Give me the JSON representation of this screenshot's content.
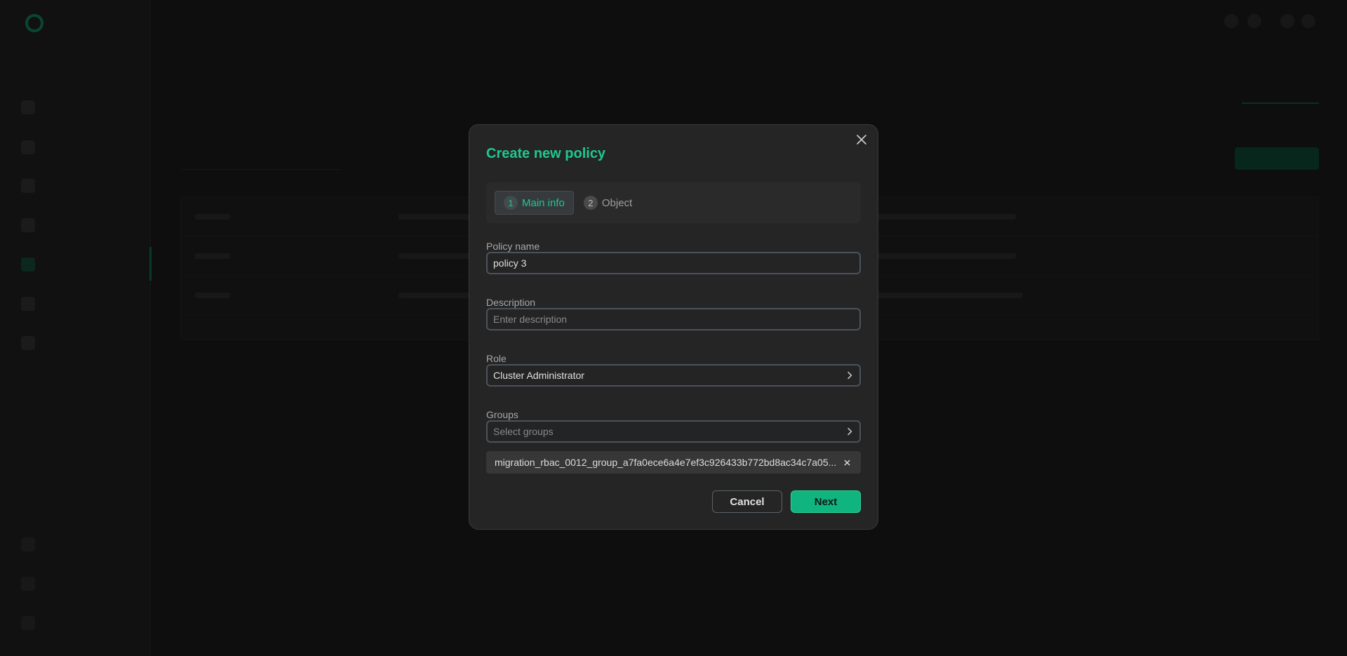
{
  "modal": {
    "title": "Create new policy",
    "steps": [
      {
        "number": "1",
        "label": "Main info",
        "active": true
      },
      {
        "number": "2",
        "label": "Object",
        "active": false
      }
    ],
    "fields": {
      "policy_name": {
        "label": "Policy name",
        "value": "policy 3"
      },
      "description": {
        "label": "Description",
        "placeholder": "Enter description"
      },
      "role": {
        "label": "Role",
        "value": "Cluster Administrator"
      },
      "groups": {
        "label": "Groups",
        "placeholder": "Select groups"
      }
    },
    "selected_groups": [
      "migration_rbac_0012_group_a7fa0ece6a4e7ef3c926433b772bd8ac34c7a05..."
    ],
    "buttons": {
      "cancel": "Cancel",
      "next": "Next"
    }
  },
  "colors": {
    "accent": "#1fc890",
    "primary_button": "#10b47e",
    "modal_bg": "#252525",
    "page_bg": "#161616"
  },
  "icons": {
    "close": "close-icon",
    "chevron": "chevron-right-icon",
    "remove_tag": "x-icon"
  }
}
